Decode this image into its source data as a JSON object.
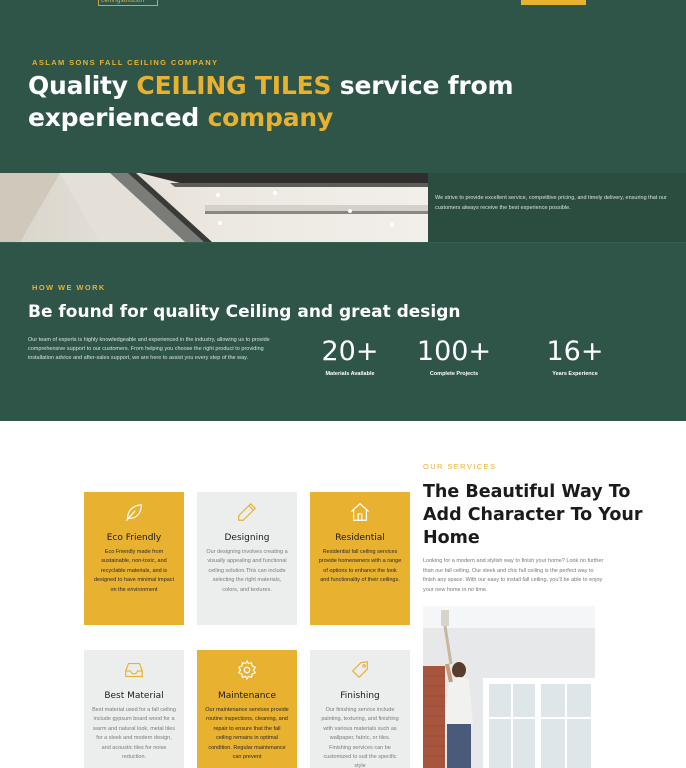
{
  "header": {
    "logo_text": "ceilingsolution"
  },
  "hero": {
    "eyebrow": "ASLAM SONS FALL CEILING COMPANY",
    "title_part1": "Quality ",
    "title_highlight1": "CEILING TILES",
    "title_part2": " service from experienced ",
    "title_highlight2": "company",
    "strip_text": "We strive to provide excellent service, competitive pricing, and timely delivery, ensuring that our customers always receive the best experience possible."
  },
  "how": {
    "eyebrow": "HOW WE WORK",
    "title": "Be found for quality Ceiling and great design",
    "text": "Our team of experts is highly knowledgeable and experienced in the industry, allowing us to provide comprehensive support to our customers. From helping you choose the right product to providing installation advice and after-sales support, we are here to assist you every step of the way.",
    "stats": [
      {
        "number": "20+",
        "label": "Materials Available"
      },
      {
        "number": "100+",
        "label": "Complete Projects"
      },
      {
        "number": "16+",
        "label": "Years Experience"
      }
    ]
  },
  "services": {
    "eyebrow": "OUR SERVICES",
    "heading": "The Beautiful Way To Add Character To Your Home",
    "description": "Looking for a modern and stylish way to finish your home? Look no further than our fall ceiling. Our sleek and chic fall ceiling is the perfect way to finish any space. With our easy to install fall ceiling, you'll be able to enjoy your new home in no time.",
    "cards": [
      {
        "title": "Eco Friendly",
        "icon": "leaf-icon",
        "text": "Eco Friendly made from sustainable, non-toxic, and recyclable materials, and is designed to have minimal impact on the environment"
      },
      {
        "title": "Designing",
        "icon": "pencil-icon",
        "text": "Our designing involves creating a visually appealing and functional ceiling solution.This can include selecting the right materials, colors, and textures."
      },
      {
        "title": "Residential",
        "icon": "home-icon",
        "text": "Residential fall ceiling services provide homeowners with a range of options to enhance the look and functionality of their ceilings."
      },
      {
        "title": "Best Material",
        "icon": "inbox-icon",
        "text": "Best material used for a fall ceiling include gypsum board wood for a warm and natural look, metal tiles for a sleek and modern design, and acoustic tiles for noise reduction."
      },
      {
        "title": "Maintenance",
        "icon": "gear-icon",
        "text": "Our maintenance services provide routine inspections, cleaning, and repair to ensure that the fall ceiling remains in optimal condition. Regular maintenance can prevent"
      },
      {
        "title": "Finishing",
        "icon": "tag-icon",
        "text": "Our finishing service include painting, texturing, and finishing with various materials such as wallpaper, fabric, or tiles. Finishing services can be customized to suit the specific style"
      }
    ]
  },
  "colors": {
    "brand_green": "#2e5547",
    "accent_gold": "#e9b130",
    "card_grey": "#eceeed"
  }
}
